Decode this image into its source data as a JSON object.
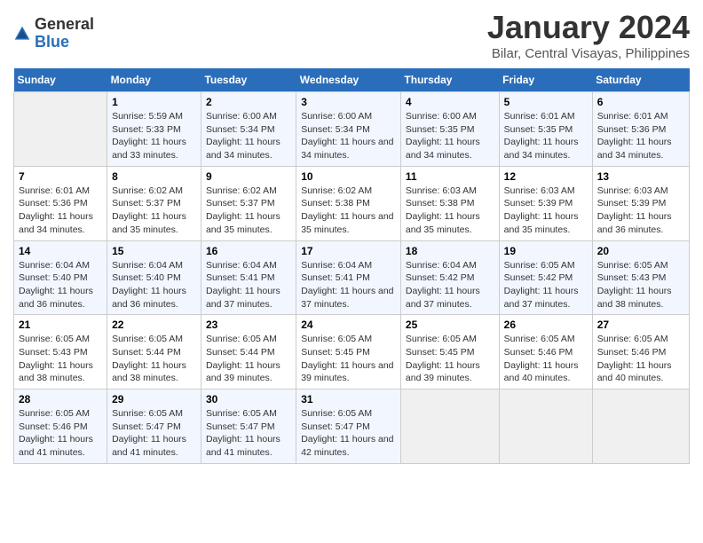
{
  "header": {
    "logo_general": "General",
    "logo_blue": "Blue",
    "title": "January 2024",
    "subtitle": "Bilar, Central Visayas, Philippines"
  },
  "days_of_week": [
    "Sunday",
    "Monday",
    "Tuesday",
    "Wednesday",
    "Thursday",
    "Friday",
    "Saturday"
  ],
  "weeks": [
    [
      {
        "num": "",
        "sunrise": "",
        "sunset": "",
        "daylight": "",
        "empty": true
      },
      {
        "num": "1",
        "sunrise": "Sunrise: 5:59 AM",
        "sunset": "Sunset: 5:33 PM",
        "daylight": "Daylight: 11 hours and 33 minutes."
      },
      {
        "num": "2",
        "sunrise": "Sunrise: 6:00 AM",
        "sunset": "Sunset: 5:34 PM",
        "daylight": "Daylight: 11 hours and 34 minutes."
      },
      {
        "num": "3",
        "sunrise": "Sunrise: 6:00 AM",
        "sunset": "Sunset: 5:34 PM",
        "daylight": "Daylight: 11 hours and 34 minutes."
      },
      {
        "num": "4",
        "sunrise": "Sunrise: 6:00 AM",
        "sunset": "Sunset: 5:35 PM",
        "daylight": "Daylight: 11 hours and 34 minutes."
      },
      {
        "num": "5",
        "sunrise": "Sunrise: 6:01 AM",
        "sunset": "Sunset: 5:35 PM",
        "daylight": "Daylight: 11 hours and 34 minutes."
      },
      {
        "num": "6",
        "sunrise": "Sunrise: 6:01 AM",
        "sunset": "Sunset: 5:36 PM",
        "daylight": "Daylight: 11 hours and 34 minutes."
      }
    ],
    [
      {
        "num": "7",
        "sunrise": "Sunrise: 6:01 AM",
        "sunset": "Sunset: 5:36 PM",
        "daylight": "Daylight: 11 hours and 34 minutes."
      },
      {
        "num": "8",
        "sunrise": "Sunrise: 6:02 AM",
        "sunset": "Sunset: 5:37 PM",
        "daylight": "Daylight: 11 hours and 35 minutes."
      },
      {
        "num": "9",
        "sunrise": "Sunrise: 6:02 AM",
        "sunset": "Sunset: 5:37 PM",
        "daylight": "Daylight: 11 hours and 35 minutes."
      },
      {
        "num": "10",
        "sunrise": "Sunrise: 6:02 AM",
        "sunset": "Sunset: 5:38 PM",
        "daylight": "Daylight: 11 hours and 35 minutes."
      },
      {
        "num": "11",
        "sunrise": "Sunrise: 6:03 AM",
        "sunset": "Sunset: 5:38 PM",
        "daylight": "Daylight: 11 hours and 35 minutes."
      },
      {
        "num": "12",
        "sunrise": "Sunrise: 6:03 AM",
        "sunset": "Sunset: 5:39 PM",
        "daylight": "Daylight: 11 hours and 35 minutes."
      },
      {
        "num": "13",
        "sunrise": "Sunrise: 6:03 AM",
        "sunset": "Sunset: 5:39 PM",
        "daylight": "Daylight: 11 hours and 36 minutes."
      }
    ],
    [
      {
        "num": "14",
        "sunrise": "Sunrise: 6:04 AM",
        "sunset": "Sunset: 5:40 PM",
        "daylight": "Daylight: 11 hours and 36 minutes."
      },
      {
        "num": "15",
        "sunrise": "Sunrise: 6:04 AM",
        "sunset": "Sunset: 5:40 PM",
        "daylight": "Daylight: 11 hours and 36 minutes."
      },
      {
        "num": "16",
        "sunrise": "Sunrise: 6:04 AM",
        "sunset": "Sunset: 5:41 PM",
        "daylight": "Daylight: 11 hours and 37 minutes."
      },
      {
        "num": "17",
        "sunrise": "Sunrise: 6:04 AM",
        "sunset": "Sunset: 5:41 PM",
        "daylight": "Daylight: 11 hours and 37 minutes."
      },
      {
        "num": "18",
        "sunrise": "Sunrise: 6:04 AM",
        "sunset": "Sunset: 5:42 PM",
        "daylight": "Daylight: 11 hours and 37 minutes."
      },
      {
        "num": "19",
        "sunrise": "Sunrise: 6:05 AM",
        "sunset": "Sunset: 5:42 PM",
        "daylight": "Daylight: 11 hours and 37 minutes."
      },
      {
        "num": "20",
        "sunrise": "Sunrise: 6:05 AM",
        "sunset": "Sunset: 5:43 PM",
        "daylight": "Daylight: 11 hours and 38 minutes."
      }
    ],
    [
      {
        "num": "21",
        "sunrise": "Sunrise: 6:05 AM",
        "sunset": "Sunset: 5:43 PM",
        "daylight": "Daylight: 11 hours and 38 minutes."
      },
      {
        "num": "22",
        "sunrise": "Sunrise: 6:05 AM",
        "sunset": "Sunset: 5:44 PM",
        "daylight": "Daylight: 11 hours and 38 minutes."
      },
      {
        "num": "23",
        "sunrise": "Sunrise: 6:05 AM",
        "sunset": "Sunset: 5:44 PM",
        "daylight": "Daylight: 11 hours and 39 minutes."
      },
      {
        "num": "24",
        "sunrise": "Sunrise: 6:05 AM",
        "sunset": "Sunset: 5:45 PM",
        "daylight": "Daylight: 11 hours and 39 minutes."
      },
      {
        "num": "25",
        "sunrise": "Sunrise: 6:05 AM",
        "sunset": "Sunset: 5:45 PM",
        "daylight": "Daylight: 11 hours and 39 minutes."
      },
      {
        "num": "26",
        "sunrise": "Sunrise: 6:05 AM",
        "sunset": "Sunset: 5:46 PM",
        "daylight": "Daylight: 11 hours and 40 minutes."
      },
      {
        "num": "27",
        "sunrise": "Sunrise: 6:05 AM",
        "sunset": "Sunset: 5:46 PM",
        "daylight": "Daylight: 11 hours and 40 minutes."
      }
    ],
    [
      {
        "num": "28",
        "sunrise": "Sunrise: 6:05 AM",
        "sunset": "Sunset: 5:46 PM",
        "daylight": "Daylight: 11 hours and 41 minutes."
      },
      {
        "num": "29",
        "sunrise": "Sunrise: 6:05 AM",
        "sunset": "Sunset: 5:47 PM",
        "daylight": "Daylight: 11 hours and 41 minutes."
      },
      {
        "num": "30",
        "sunrise": "Sunrise: 6:05 AM",
        "sunset": "Sunset: 5:47 PM",
        "daylight": "Daylight: 11 hours and 41 minutes."
      },
      {
        "num": "31",
        "sunrise": "Sunrise: 6:05 AM",
        "sunset": "Sunset: 5:47 PM",
        "daylight": "Daylight: 11 hours and 42 minutes."
      },
      {
        "num": "",
        "sunrise": "",
        "sunset": "",
        "daylight": "",
        "empty": true
      },
      {
        "num": "",
        "sunrise": "",
        "sunset": "",
        "daylight": "",
        "empty": true
      },
      {
        "num": "",
        "sunrise": "",
        "sunset": "",
        "daylight": "",
        "empty": true
      }
    ]
  ]
}
